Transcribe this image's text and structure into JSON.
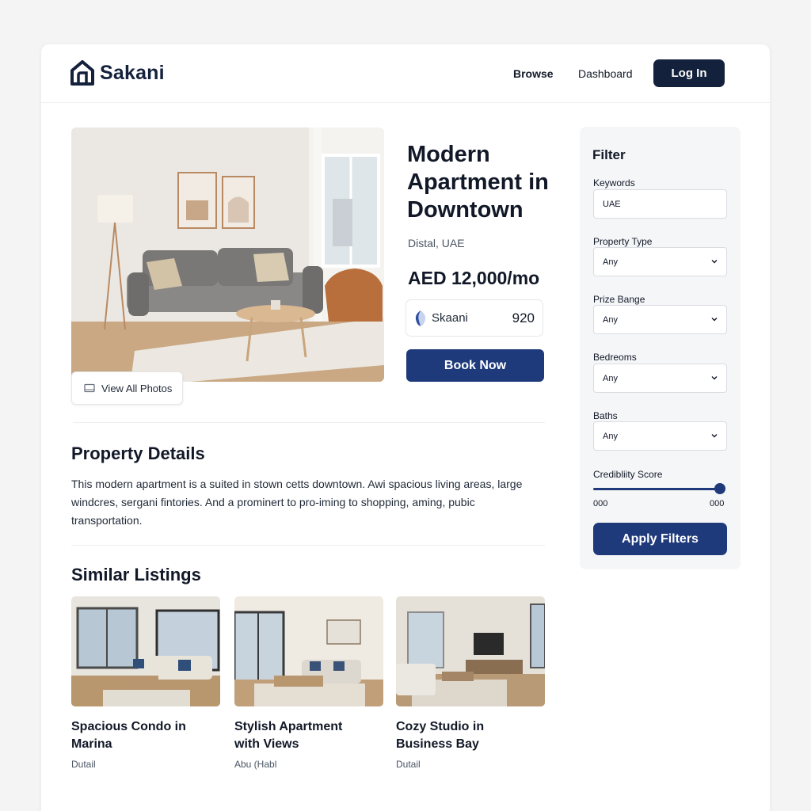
{
  "brand": {
    "name": "Sakani"
  },
  "nav": {
    "browse": "Browse",
    "dashboard": "Dashboard",
    "login": "Log In"
  },
  "listing": {
    "title": "Modern Apartment in Downtown",
    "location": "Distal, UAE",
    "price": "AED 12,000/mo",
    "score_brand": "Skaani",
    "score_value": "920",
    "book_label": "Book Now",
    "view_photos": "View All Photos"
  },
  "details": {
    "heading": "Property Details",
    "text": "This modern apartment is a suited in stown cetts downtown. Awi spacious living areas, large windcres, sergani fintories. And a prominert to pro-iming to shopping, aming, pubic transportation."
  },
  "similar": {
    "heading": "Similar Listings",
    "items": [
      {
        "title": "Spacious Condo in Marina",
        "location": "Dutail"
      },
      {
        "title": "Stylish Apartment with Views",
        "location": "Abu (Habl"
      },
      {
        "title": "Cozy Studio in Business Bay",
        "location": "Dutail"
      }
    ]
  },
  "filter": {
    "heading": "Filter",
    "keywords_label": "Keywords",
    "keywords_value": "UAE",
    "property_type_label": "Property Type",
    "property_type_value": "Any",
    "price_range_label": "Prize Bange",
    "price_range_value": "Any",
    "bedrooms_label": "Bedreoms",
    "bedrooms_value": "Any",
    "baths_label": "Baths",
    "baths_value": "Any",
    "credibility_label": "Credibliity Score",
    "credibility_min": "000",
    "credibility_max": "000",
    "credibility_level": 1.0,
    "apply_label": "Apply Filters"
  },
  "colors": {
    "navy": "#14213d",
    "primary": "#1e3a7b"
  },
  "icons": {
    "logo": "house-logo-icon",
    "photos": "image-icon",
    "chevron": "chevron-down-icon",
    "score": "shield-badge-icon"
  }
}
